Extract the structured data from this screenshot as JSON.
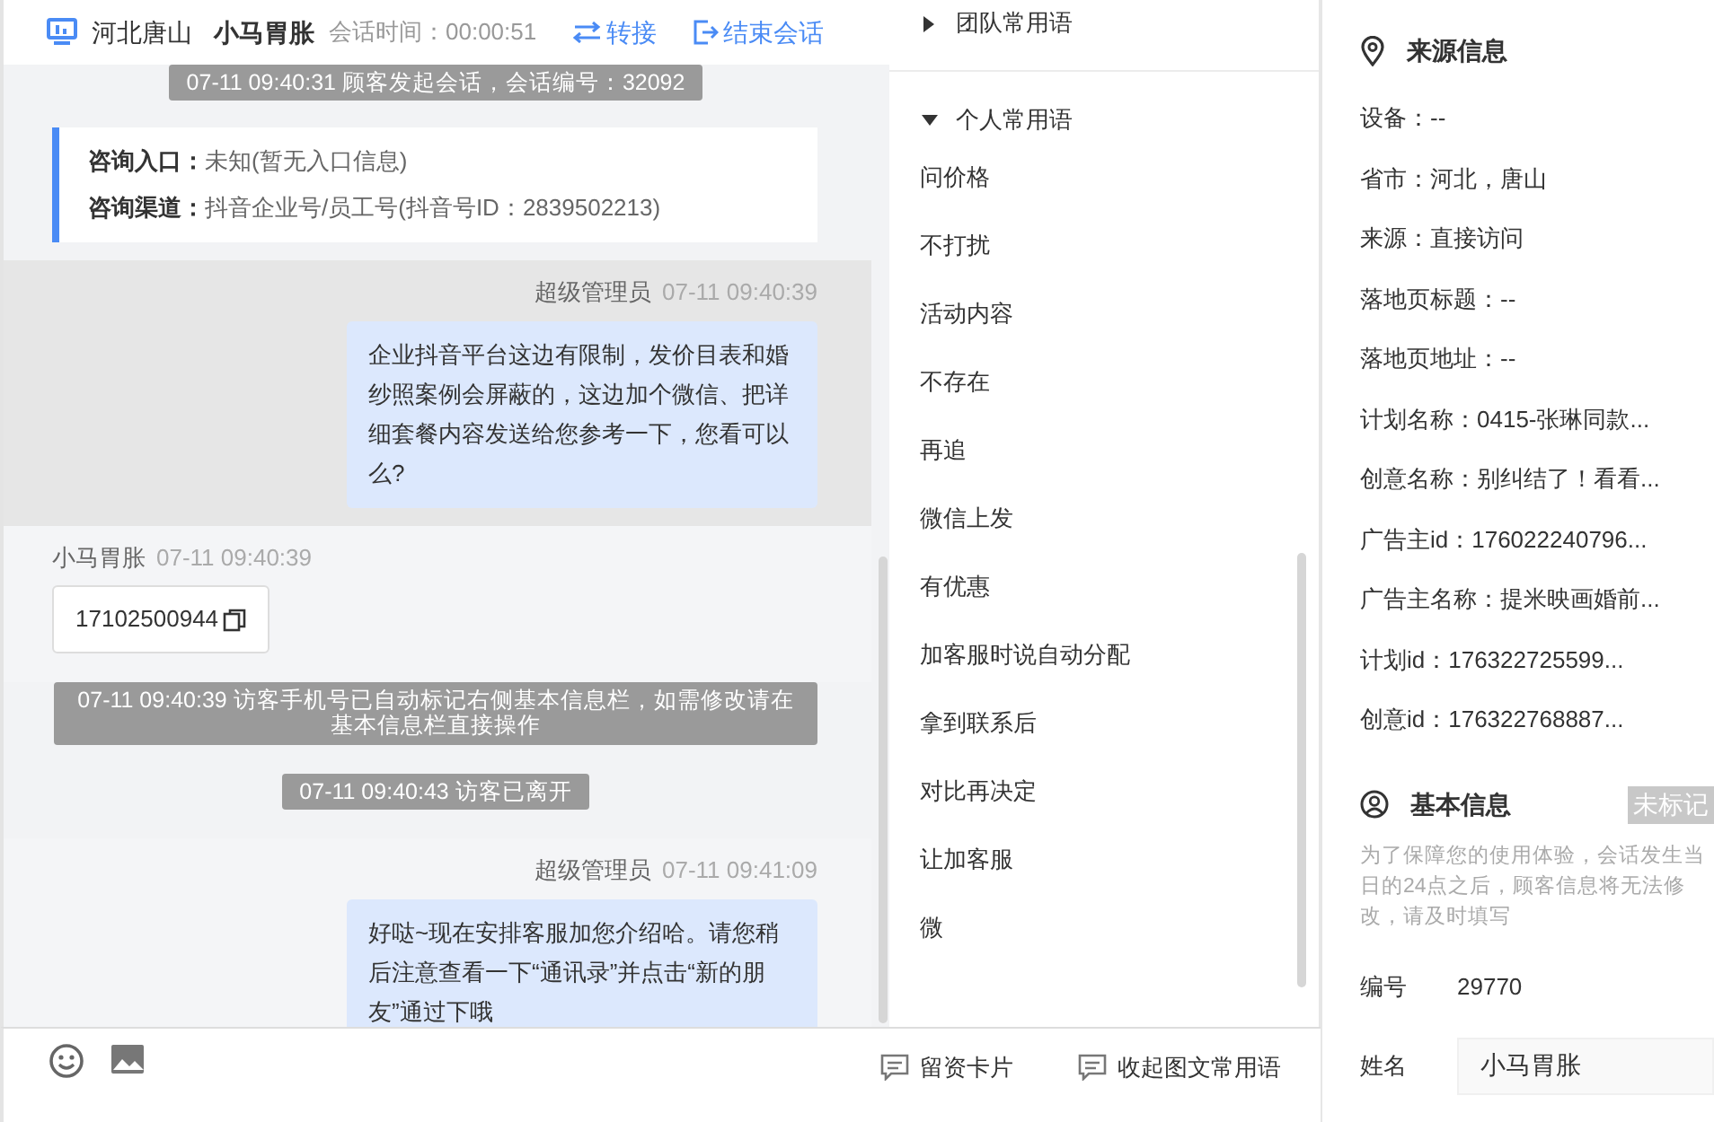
{
  "header": {
    "location": "河北唐山",
    "visitor_name": "小马胃胀",
    "session_time": "会话时间：00:00:51",
    "transfer_button": "转接",
    "end_button": "结束会话"
  },
  "messages": [
    {
      "kind": "system",
      "text": "07-11 09:40:31 顾客发起会话，会话编号：32092"
    },
    {
      "kind": "entry",
      "rows": [
        {
          "label": "咨询入口：",
          "value": "未知(暂无入口信息)"
        },
        {
          "label": "咨询渠道：",
          "value": "抖音企业号/员工号(抖音号ID：2839502213)"
        }
      ]
    },
    {
      "kind": "agent",
      "highlighted": true,
      "sender": "超级管理员",
      "time": "07-11 09:40:39",
      "text": "企业抖音平台这边有限制，发价目表和婚纱照案例会屏蔽的，这边加个微信、把详细套餐内容发送给您参考一下，您看可以么?"
    },
    {
      "kind": "visitor",
      "highlighted": false,
      "sender": "小马胃胀",
      "time": "07-11 09:40:39",
      "text": "17102500944"
    },
    {
      "kind": "system",
      "text": "07-11 09:40:39 访客手机号已自动标记右侧基本信息栏，如需修改请在基本信息栏直接操作"
    },
    {
      "kind": "system",
      "text": "07-11 09:40:43 访客已离开"
    },
    {
      "kind": "agent",
      "highlighted": false,
      "sender": "超级管理员",
      "time": "07-11 09:41:09",
      "text": "好哒~现在安排客服加您介绍哈。请您稍后注意查看一下“通讯录”并点击“新的朋友”通过下哦"
    }
  ],
  "phrase_groups": [
    {
      "title": "团队常用语",
      "expanded": false
    },
    {
      "title": "个人常用语",
      "expanded": true,
      "items": [
        "问价格",
        "不打扰",
        "活动内容",
        "不存在",
        "再追",
        "微信上发",
        "有优惠",
        "加客服时说自动分配",
        "拿到联系后",
        "对比再决定",
        "让加客服",
        "微"
      ]
    }
  ],
  "toolbar": {
    "buttons": [
      "留资卡片",
      "收起图文常用语"
    ]
  },
  "source_info": {
    "title": "来源信息",
    "fields": [
      "设备：--",
      "省市：河北，唐山",
      "来源：直接访问",
      "落地页标题：--",
      "落地页地址：--",
      "计划名称：0415-张琳同款...",
      "创意名称：别纠结了！看看...",
      "广告主id：176022240796...",
      "广告主名称：提米映画婚前...",
      "计划id：176322725599...",
      "创意id：176322768887..."
    ]
  },
  "basic_info": {
    "title": "基本信息",
    "tag": "未标记",
    "notice": "为了保障您的使用体验，会话发生当日的24点之后，顾客信息将无法修改，请及时填写",
    "fields": [
      {
        "kind": "text",
        "label": "编号",
        "value": "29770"
      },
      {
        "kind": "input",
        "label": "姓名",
        "value": "小马胃胀"
      }
    ]
  }
}
